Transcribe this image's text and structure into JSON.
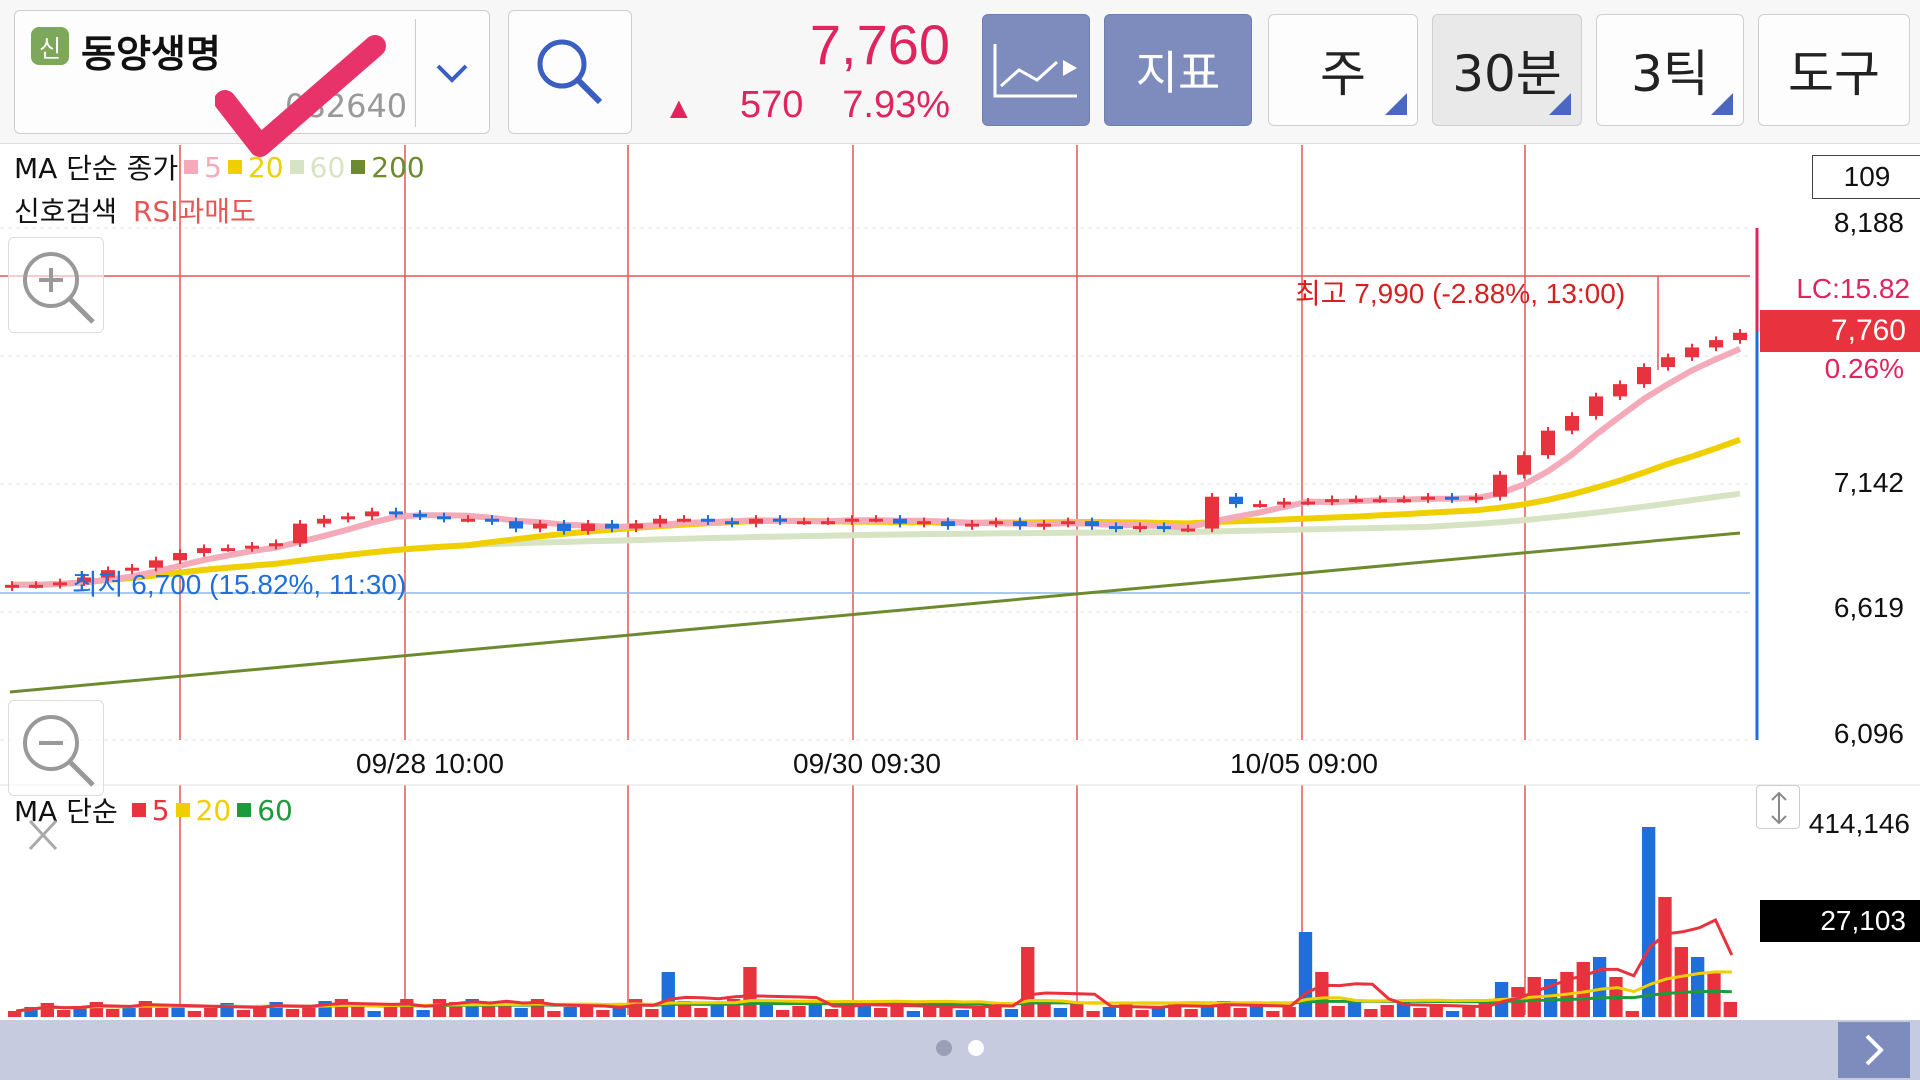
{
  "stock": {
    "badge": "신",
    "name": "동양생명",
    "code": "082640"
  },
  "quote": {
    "price": "7,760",
    "change_arrow": "▲",
    "change": "570",
    "change_pct": "7.93%"
  },
  "toolbar": {
    "indicator": "지표",
    "period_week": "주",
    "period_30m": "30분",
    "tick": "3틱",
    "tools": "도구"
  },
  "colors": {
    "up": "#e0245e",
    "down": "#1e6fd9",
    "accent": "#7d8cbd"
  },
  "legend": {
    "ma_label": "MA 단순 종가",
    "ma5": "5",
    "ma20": "20",
    "ma60": "60",
    "ma200": "200",
    "signal_label": "신호검색",
    "signal_value": "RSI과매도",
    "vol_label": "MA 단순",
    "vol5": "5",
    "vol20": "20",
    "vol60": "60"
  },
  "yaxis": {
    "top_box": "109",
    "ticks": [
      "8,188",
      "7,142",
      "6,619",
      "6,096"
    ],
    "lc": "LC:15.82",
    "current": "7,760",
    "current_pct": "0.26%"
  },
  "annotations": {
    "high": "최고 7,990 (-2.88%, 13:00)",
    "low": "최저 6,700 (15.82%, 11:30)"
  },
  "xaxis": {
    "ticks": [
      "09/28 10:00",
      "09/30 09:30",
      "10/05 09:00"
    ]
  },
  "volume": {
    "top": "414,146",
    "current": "27,103"
  },
  "icons": {
    "search": "search-icon",
    "dropdown": "chevron-down-icon",
    "chart": "line-chart-icon",
    "zoom_in": "zoom-in-icon",
    "zoom_out": "zoom-out-icon",
    "close": "close-icon",
    "resize": "resize-icon",
    "next": "chevron-right-icon"
  }
}
